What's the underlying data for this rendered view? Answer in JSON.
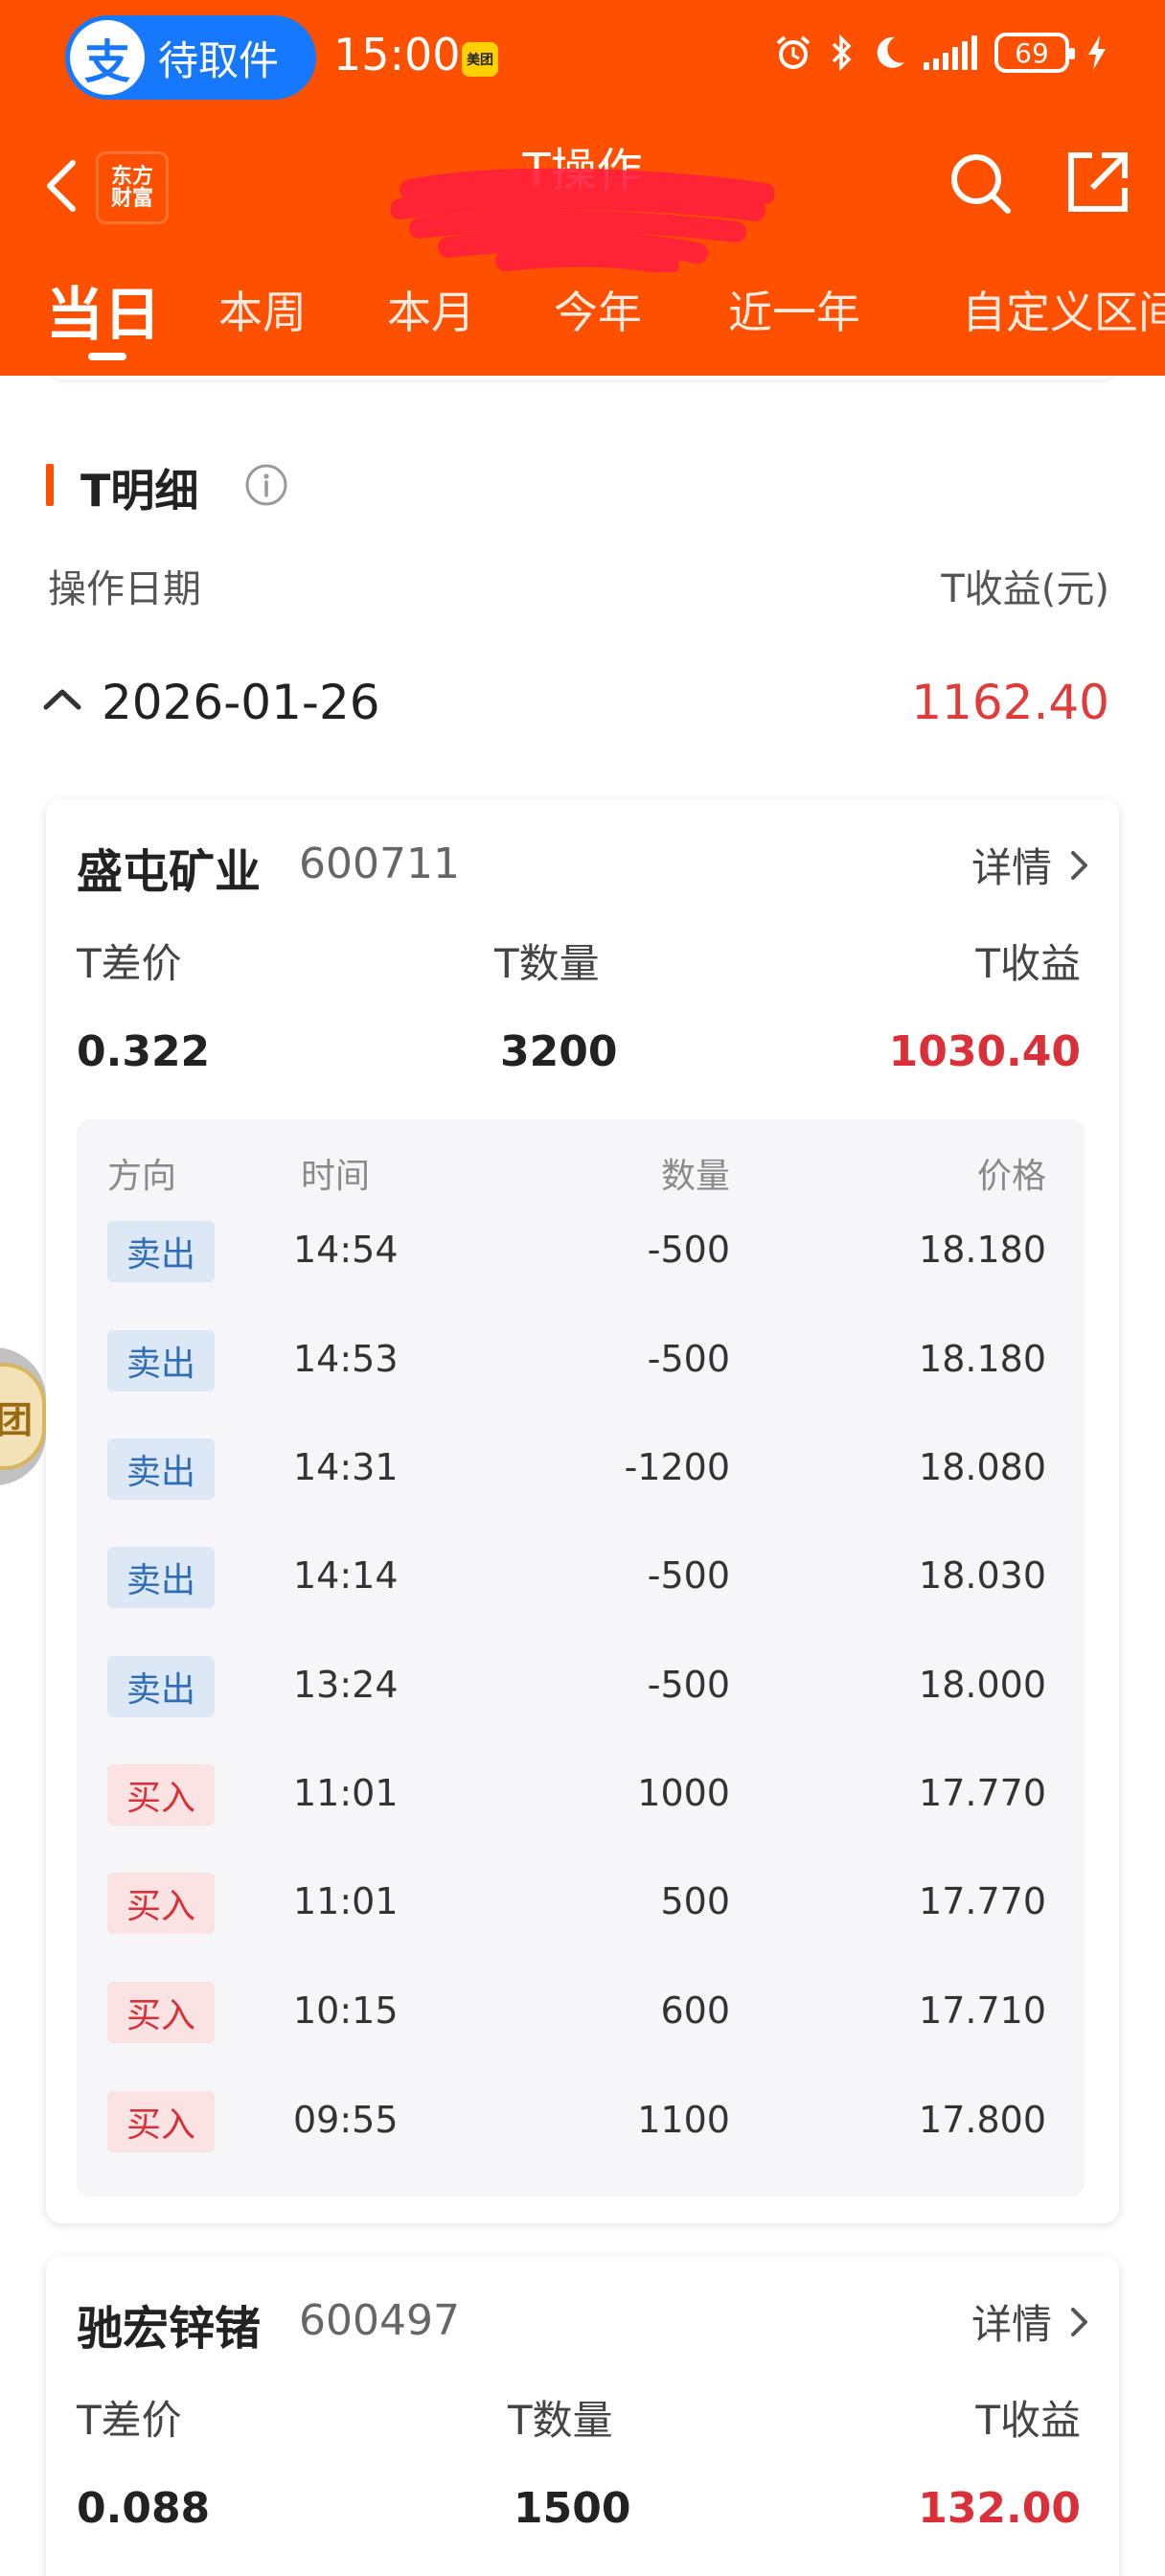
{
  "status_bar": {
    "alipay_pill_text": "待取件",
    "alipay_logo_char": "支",
    "time": "15:00",
    "meituan_badge": "美团",
    "battery_level": "69"
  },
  "navbar": {
    "title": "T操作",
    "brand_logo_line1": "东方",
    "brand_logo_line2": "财富"
  },
  "tabs": [
    {
      "label": "当日",
      "active": true
    },
    {
      "label": "本周"
    },
    {
      "label": "本月"
    },
    {
      "label": "今年"
    },
    {
      "label": "近一年"
    },
    {
      "label": "自定义区间"
    }
  ],
  "section": {
    "title": "T明细",
    "col_date_label": "操作日期",
    "col_profit_label": "T收益(元)"
  },
  "date_group": {
    "date": "2026-01-26",
    "profit": "1162.40"
  },
  "stocks": [
    {
      "name": "盛屯矿业",
      "code": "600711",
      "detail_label": "详情",
      "labels": {
        "diff": "T差价",
        "qty": "T数量",
        "profit": "T收益"
      },
      "diff": "0.322",
      "qty": "3200",
      "profit": "1030.40",
      "table_headers": {
        "direction": "方向",
        "time": "时间",
        "quantity": "数量",
        "price": "价格"
      },
      "trades": [
        {
          "dir": "卖出",
          "type": "sell",
          "time": "14:54",
          "qty": "-500",
          "price": "18.180"
        },
        {
          "dir": "卖出",
          "type": "sell",
          "time": "14:53",
          "qty": "-500",
          "price": "18.180"
        },
        {
          "dir": "卖出",
          "type": "sell",
          "time": "14:31",
          "qty": "-1200",
          "price": "18.080"
        },
        {
          "dir": "卖出",
          "type": "sell",
          "time": "14:14",
          "qty": "-500",
          "price": "18.030"
        },
        {
          "dir": "卖出",
          "type": "sell",
          "time": "13:24",
          "qty": "-500",
          "price": "18.000"
        },
        {
          "dir": "买入",
          "type": "buy",
          "time": "11:01",
          "qty": "1000",
          "price": "17.770"
        },
        {
          "dir": "买入",
          "type": "buy",
          "time": "11:01",
          "qty": "500",
          "price": "17.770"
        },
        {
          "dir": "买入",
          "type": "buy",
          "time": "10:15",
          "qty": "600",
          "price": "17.710"
        },
        {
          "dir": "买入",
          "type": "buy",
          "time": "09:55",
          "qty": "1100",
          "price": "17.800"
        }
      ]
    },
    {
      "name": "驰宏锌锗",
      "code": "600497",
      "detail_label": "详情",
      "labels": {
        "diff": "T差价",
        "qty": "T数量",
        "profit": "T收益"
      },
      "diff": "0.088",
      "qty": "1500",
      "profit": "132.00"
    }
  ],
  "floating_badge_char": "团",
  "colors": {
    "brand_orange": "#ff5000",
    "profit_red": "#d9303a",
    "sell_blue": "#2f6db5",
    "buy_red": "#d9303a",
    "alipay_blue": "#1677ff"
  },
  "icons": [
    "back-arrow-icon",
    "search-icon",
    "share-icon",
    "info-icon",
    "collapse-chevron-icon",
    "chevron-right-icon",
    "alarm-icon",
    "bluetooth-icon",
    "moon-icon",
    "signal-icon",
    "battery-icon",
    "charging-icon"
  ]
}
